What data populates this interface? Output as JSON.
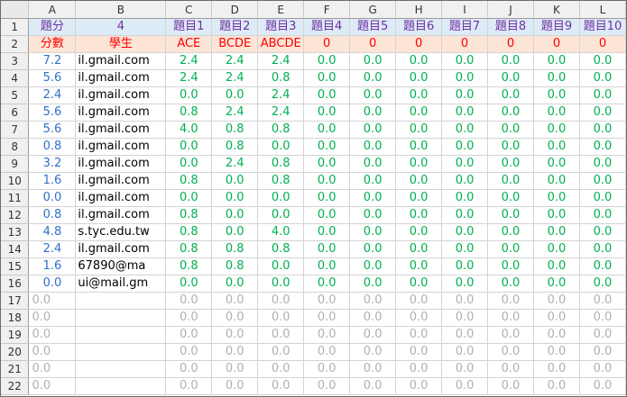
{
  "sheet": {
    "columns": [
      "A",
      "B",
      "C",
      "D",
      "E",
      "F",
      "G",
      "H",
      "I",
      "J",
      "K",
      "L"
    ],
    "header_row_1": [
      "題分",
      "4",
      "題目1",
      "題目2",
      "題目3",
      "題目4",
      "題目5",
      "題目6",
      "題目7",
      "題目8",
      "題目9",
      "題目10"
    ],
    "header_row_2": [
      "分數",
      "學生",
      "ACE",
      "BCDE",
      "ABCDE",
      "0",
      "0",
      "0",
      "0",
      "0",
      "0",
      "0"
    ],
    "students": [
      {
        "row": "3",
        "score": "7.2",
        "student": "il.gmail.com",
        "items": [
          "2.4",
          "2.4",
          "2.4",
          "0.0",
          "0.0",
          "0.0",
          "0.0",
          "0.0",
          "0.0",
          "0.0"
        ]
      },
      {
        "row": "4",
        "score": "5.6",
        "student": "il.gmail.com",
        "items": [
          "2.4",
          "2.4",
          "0.8",
          "0.0",
          "0.0",
          "0.0",
          "0.0",
          "0.0",
          "0.0",
          "0.0"
        ]
      },
      {
        "row": "5",
        "score": "2.4",
        "student": "il.gmail.com",
        "items": [
          "0.0",
          "0.0",
          "2.4",
          "0.0",
          "0.0",
          "0.0",
          "0.0",
          "0.0",
          "0.0",
          "0.0"
        ]
      },
      {
        "row": "6",
        "score": "5.6",
        "student": "il.gmail.com",
        "items": [
          "0.8",
          "2.4",
          "2.4",
          "0.0",
          "0.0",
          "0.0",
          "0.0",
          "0.0",
          "0.0",
          "0.0"
        ]
      },
      {
        "row": "7",
        "score": "5.6",
        "student": "il.gmail.com",
        "items": [
          "4.0",
          "0.8",
          "0.8",
          "0.0",
          "0.0",
          "0.0",
          "0.0",
          "0.0",
          "0.0",
          "0.0"
        ]
      },
      {
        "row": "8",
        "score": "0.8",
        "student": "il.gmail.com",
        "items": [
          "0.0",
          "0.8",
          "0.0",
          "0.0",
          "0.0",
          "0.0",
          "0.0",
          "0.0",
          "0.0",
          "0.0"
        ]
      },
      {
        "row": "9",
        "score": "3.2",
        "student": "il.gmail.com",
        "items": [
          "0.0",
          "2.4",
          "0.8",
          "0.0",
          "0.0",
          "0.0",
          "0.0",
          "0.0",
          "0.0",
          "0.0"
        ]
      },
      {
        "row": "10",
        "score": "1.6",
        "student": "il.gmail.com",
        "items": [
          "0.8",
          "0.0",
          "0.8",
          "0.0",
          "0.0",
          "0.0",
          "0.0",
          "0.0",
          "0.0",
          "0.0"
        ]
      },
      {
        "row": "11",
        "score": "0.0",
        "student": "il.gmail.com",
        "items": [
          "0.0",
          "0.0",
          "0.0",
          "0.0",
          "0.0",
          "0.0",
          "0.0",
          "0.0",
          "0.0",
          "0.0"
        ]
      },
      {
        "row": "12",
        "score": "0.8",
        "student": "il.gmail.com",
        "items": [
          "0.8",
          "0.0",
          "0.0",
          "0.0",
          "0.0",
          "0.0",
          "0.0",
          "0.0",
          "0.0",
          "0.0"
        ]
      },
      {
        "row": "13",
        "score": "4.8",
        "student": "s.tyc.edu.tw",
        "items": [
          "0.8",
          "0.0",
          "4.0",
          "0.0",
          "0.0",
          "0.0",
          "0.0",
          "0.0",
          "0.0",
          "0.0"
        ]
      },
      {
        "row": "14",
        "score": "2.4",
        "student": "il.gmail.com",
        "items": [
          "0.8",
          "0.8",
          "0.8",
          "0.0",
          "0.0",
          "0.0",
          "0.0",
          "0.0",
          "0.0",
          "0.0"
        ]
      },
      {
        "row": "15",
        "score": "1.6",
        "student": "67890@ma",
        "items": [
          "0.8",
          "0.8",
          "0.0",
          "0.0",
          "0.0",
          "0.0",
          "0.0",
          "0.0",
          "0.0",
          "0.0"
        ]
      },
      {
        "row": "16",
        "score": "0.0",
        "student": "ui@mail.gm",
        "items": [
          "0.0",
          "0.0",
          "0.0",
          "0.0",
          "0.0",
          "0.0",
          "0.0",
          "0.0",
          "0.0",
          "0.0"
        ]
      }
    ],
    "empty_rows": [
      {
        "row": "17",
        "score": "0.0",
        "items": [
          "0.0",
          "0.0",
          "0.0",
          "0.0",
          "0.0",
          "0.0",
          "0.0",
          "0.0",
          "0.0",
          "0.0"
        ]
      },
      {
        "row": "18",
        "score": "0.0",
        "items": [
          "0.0",
          "0.0",
          "0.0",
          "0.0",
          "0.0",
          "0.0",
          "0.0",
          "0.0",
          "0.0",
          "0.0"
        ]
      },
      {
        "row": "19",
        "score": "0.0",
        "items": [
          "0.0",
          "0.0",
          "0.0",
          "0.0",
          "0.0",
          "0.0",
          "0.0",
          "0.0",
          "0.0",
          "0.0"
        ]
      },
      {
        "row": "20",
        "score": "0.0",
        "items": [
          "0.0",
          "0.0",
          "0.0",
          "0.0",
          "0.0",
          "0.0",
          "0.0",
          "0.0",
          "0.0",
          "0.0"
        ]
      },
      {
        "row": "21",
        "score": "0.0",
        "items": [
          "0.0",
          "0.0",
          "0.0",
          "0.0",
          "0.0",
          "0.0",
          "0.0",
          "0.0",
          "0.0",
          "0.0"
        ]
      },
      {
        "row": "22",
        "score": "0.0",
        "items": [
          "0.0",
          "0.0",
          "0.0",
          "0.0",
          "0.0",
          "0.0",
          "0.0",
          "0.0",
          "0.0",
          "0.0"
        ]
      }
    ]
  }
}
